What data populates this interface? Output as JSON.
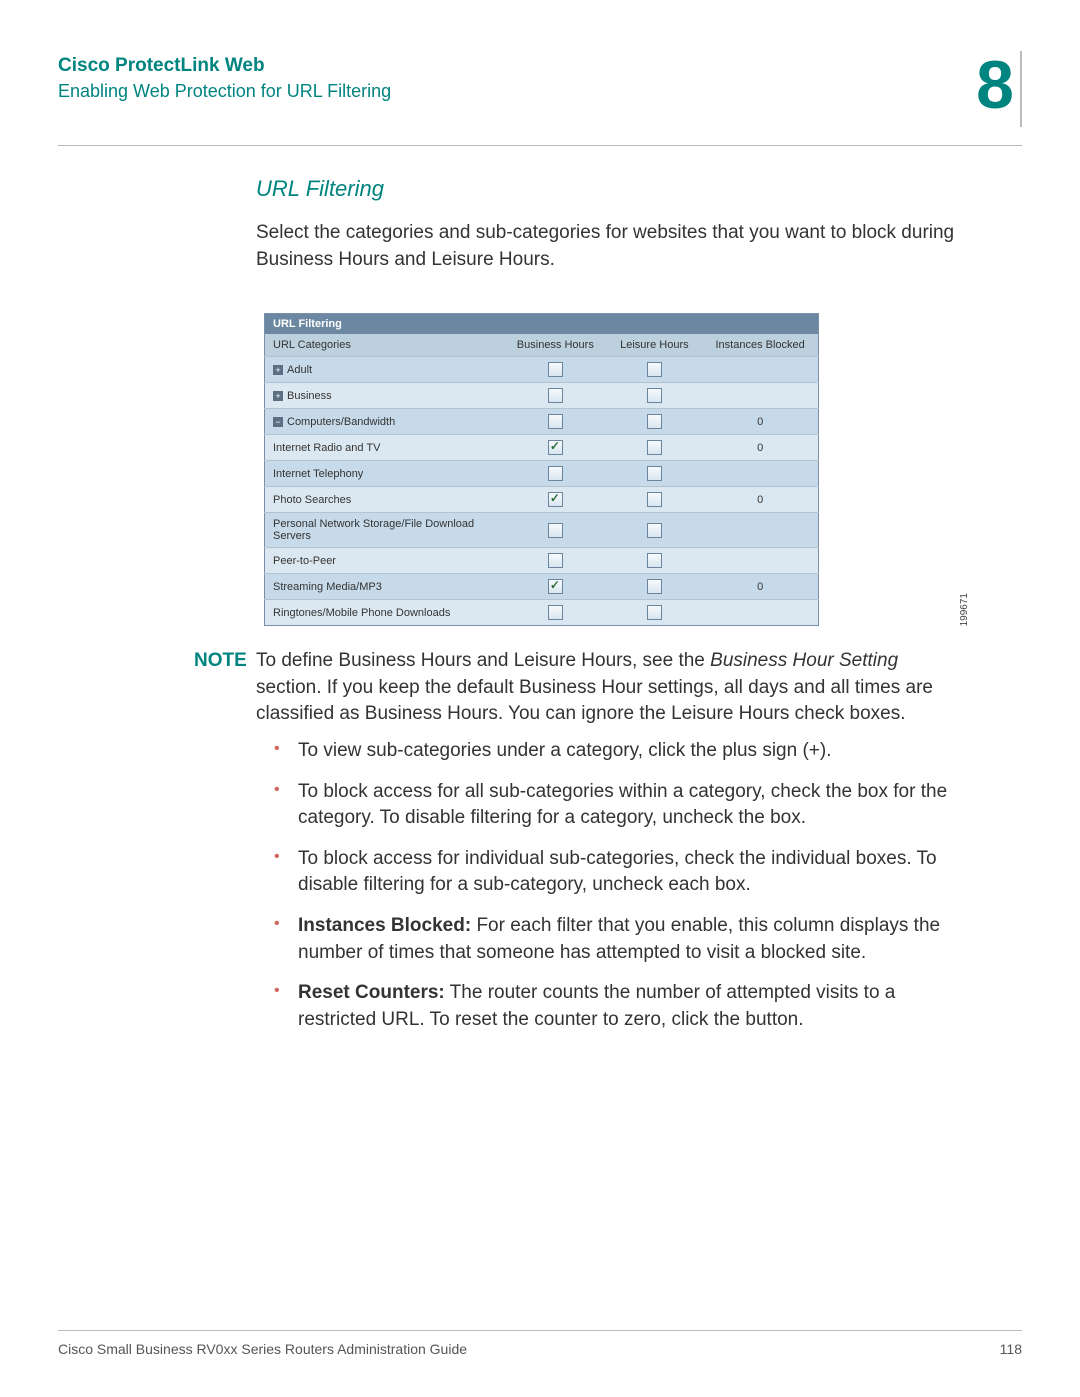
{
  "header": {
    "title": "Cisco ProtectLink Web",
    "subtitle": "Enabling Web Protection for URL Filtering",
    "chapter": "8"
  },
  "section": {
    "heading": "URL Filtering",
    "intro": "Select the categories and sub-categories for websites that you want to block during Business Hours and Leisure Hours."
  },
  "table": {
    "section_title": "URL Filtering",
    "headers": {
      "cat": "URL Categories",
      "bus": "Business Hours",
      "leis": "Leisure Hours",
      "inst": "Instances Blocked"
    },
    "rows": [
      {
        "toggler": "+",
        "name": "Adult",
        "bus": false,
        "leis": false,
        "inst": "",
        "alt": true
      },
      {
        "toggler": "+",
        "name": "Business",
        "bus": false,
        "leis": false,
        "inst": "",
        "alt": false
      },
      {
        "toggler": "−",
        "name": "Computers/Bandwidth",
        "bus": false,
        "leis": false,
        "inst": "0",
        "alt": true
      },
      {
        "toggler": "",
        "name": "Internet Radio and TV",
        "bus": true,
        "leis": false,
        "inst": "0",
        "alt": false
      },
      {
        "toggler": "",
        "name": "Internet Telephony",
        "bus": false,
        "leis": false,
        "inst": "",
        "alt": true
      },
      {
        "toggler": "",
        "name": "Photo Searches",
        "bus": true,
        "leis": false,
        "inst": "0",
        "alt": false
      },
      {
        "toggler": "",
        "name": "Personal Network Storage/File Download Servers",
        "bus": false,
        "leis": false,
        "inst": "",
        "alt": true
      },
      {
        "toggler": "",
        "name": "Peer-to-Peer",
        "bus": false,
        "leis": false,
        "inst": "",
        "alt": false
      },
      {
        "toggler": "",
        "name": "Streaming Media/MP3",
        "bus": true,
        "leis": false,
        "inst": "0",
        "alt": true
      },
      {
        "toggler": "",
        "name": "Ringtones/Mobile Phone Downloads",
        "bus": false,
        "leis": false,
        "inst": "",
        "alt": false
      }
    ],
    "figure_no": "199671"
  },
  "note": {
    "label": "NOTE",
    "prefix": "To define Business Hours and Leisure Hours, see the ",
    "em": "Business Hour Setting",
    "suffix": " section. If you keep the default Business Hour settings, all days and all times are classified as Business Hours. You can ignore the Leisure Hours check boxes."
  },
  "bullets": [
    {
      "text": "To view sub-categories under a category, click the plus sign (+)."
    },
    {
      "text": "To block access for all sub-categories within a category, check the box for the category. To disable filtering for a category, uncheck the box."
    },
    {
      "text": "To block access for individual sub-categories, check the individual boxes. To disable filtering for a sub-category, uncheck each box."
    },
    {
      "bold": "Instances Blocked:",
      "text": " For each filter that you enable, this column displays the number of times that someone has attempted to visit a blocked site."
    },
    {
      "bold": "Reset Counters:",
      "text": " The router counts the number of attempted visits to a restricted URL. To reset the counter to zero, click the button."
    }
  ],
  "footer": {
    "left": "Cisco Small Business RV0xx Series Routers Administration Guide",
    "right": "118"
  }
}
